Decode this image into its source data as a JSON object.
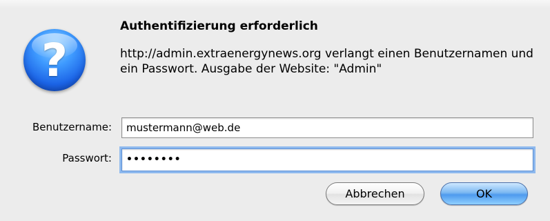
{
  "dialog": {
    "title": "Authentifizierung erforderlich",
    "message": "http://admin.extraenergynews.org verlangt einen Benutzernamen und ein Passwort. Ausgabe der Website: \"Admin\"",
    "icon": "question-mark-icon",
    "icon_glyph": "?"
  },
  "form": {
    "username_label": "Benutzername:",
    "username_value": "mustermann@web.de",
    "password_label": "Passwort:",
    "password_value": "••••••••"
  },
  "buttons": {
    "cancel_label": "Abbrechen",
    "ok_label": "OK"
  },
  "colors": {
    "background": "#ececec",
    "accent": "#4e9aee",
    "focus_ring": "#8eb9ee"
  }
}
